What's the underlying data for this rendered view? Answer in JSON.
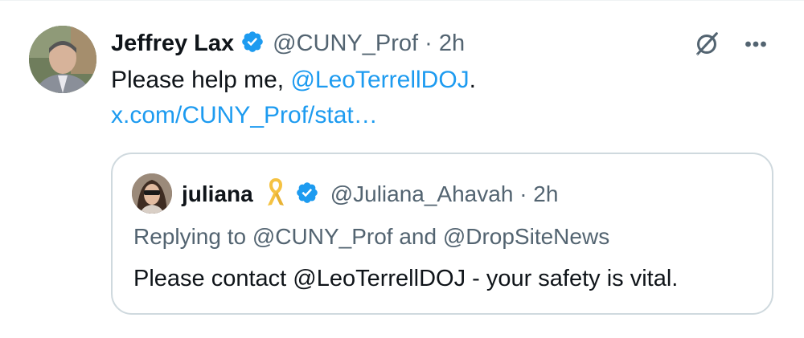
{
  "tweet": {
    "author_name": "Jeffrey Lax",
    "author_handle": "@CUNY_Prof",
    "separator": "·",
    "time": "2h",
    "verified_icon": "verified-badge-icon",
    "text_prefix": "Please help me, ",
    "mention": "@LeoTerrellDOJ",
    "text_suffix": ".",
    "link": "x.com/CUNY_Prof/stat…",
    "icons": [
      "grok-icon",
      "more-options-icon"
    ]
  },
  "quote": {
    "author_name": "juliana",
    "emoji_icon": "yellow-ribbon-icon",
    "verified_icon": "verified-badge-icon",
    "author_handle": "@Juliana_Ahavah",
    "separator": "·",
    "time": "2h",
    "replying_to": "Replying to @CUNY_Prof and @DropSiteNews",
    "text": "Please contact @LeoTerrellDOJ - your safety is vital."
  },
  "colors": {
    "link": "#1d9bf0",
    "secondary": "#536471",
    "border": "#cfd9de",
    "ribbon": "#f5c242"
  }
}
